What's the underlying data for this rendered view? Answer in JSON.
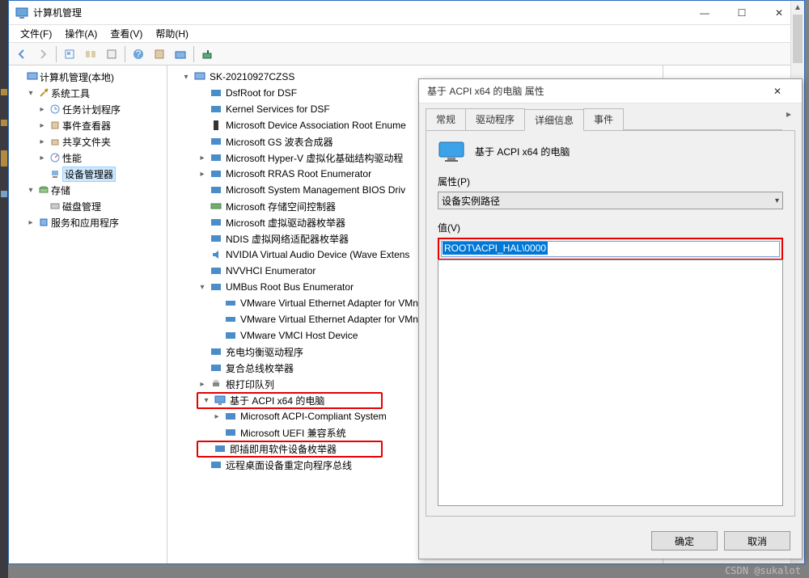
{
  "window": {
    "title": "计算机管理",
    "min": "—",
    "max": "☐",
    "close": "✕"
  },
  "menus": [
    "文件(F)",
    "操作(A)",
    "查看(V)",
    "帮助(H)"
  ],
  "left_tree": {
    "root": "计算机管理(本地)",
    "systools": "系统工具",
    "systools_items": [
      "任务计划程序",
      "事件查看器",
      "共享文件夹",
      "性能",
      "设备管理器"
    ],
    "storage": "存储",
    "storage_items": [
      "磁盘管理"
    ],
    "services": "服务和应用程序"
  },
  "device_tree": {
    "root": "SK-20210927CZSS",
    "items": [
      "DsfRoot for DSF",
      "Kernel Services for DSF",
      "Microsoft Device Association Root Enume",
      "Microsoft GS 波表合成器",
      "Microsoft Hyper-V 虚拟化基础结构驱动程",
      "Microsoft RRAS Root Enumerator",
      "Microsoft System Management BIOS Driv",
      "Microsoft 存储空间控制器",
      "Microsoft 虚拟驱动器枚举器",
      "NDIS 虚拟网络适配器枚举器",
      "NVIDIA Virtual Audio Device (Wave Extens",
      "NVVHCI Enumerator"
    ],
    "umbus": "UMBus Root Bus Enumerator",
    "umbus_children": [
      "VMware Virtual Ethernet Adapter for VMn",
      "VMware Virtual Ethernet Adapter for VMn",
      "VMware VMCI Host Device"
    ],
    "after_umbus": [
      "充电均衡驱动程序",
      "复合总线枚举器",
      "根打印队列"
    ],
    "acpi": "基于 ACPI x64 的电脑",
    "acpi_children": [
      "Microsoft ACPI-Compliant System",
      "Microsoft UEFI 兼容系统"
    ],
    "pnp": "即插即用软件设备枚举器",
    "last": "远程桌面设备重定向程序总线"
  },
  "dialog": {
    "title": "基于 ACPI x64 的电脑 属性",
    "tabs": [
      "常规",
      "驱动程序",
      "详细信息",
      "事件"
    ],
    "active_tab": 2,
    "device_name": "基于 ACPI x64 的电脑",
    "property_label": "属性(P)",
    "property_selected": "设备实例路径",
    "value_label": "值(V)",
    "value_text": "ROOT\\ACPI_HAL\\0000",
    "ok": "确定",
    "cancel": "取消"
  },
  "watermark": "CSDN @sukalot"
}
